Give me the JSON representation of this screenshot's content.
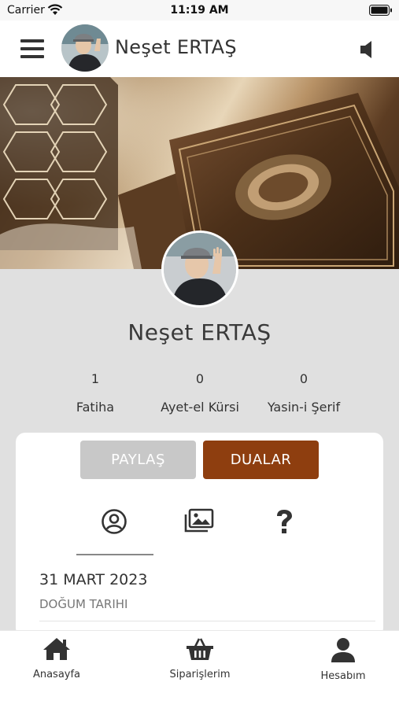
{
  "status_bar": {
    "carrier": "Carrier",
    "time": "11:19 AM"
  },
  "nav": {
    "title": "Neşet ERTAŞ",
    "menu_icon": "hamburger-icon",
    "sound_icon": "speaker-icon"
  },
  "profile": {
    "name": "Neşet ERTAŞ"
  },
  "stats": [
    {
      "count": "1",
      "label": "Fatiha"
    },
    {
      "count": "0",
      "label": "Ayet-el Kürsi"
    },
    {
      "count": "0",
      "label": "Yasin-i Şerif"
    }
  ],
  "card": {
    "share_label": "PAYLAŞ",
    "prayers_label": "DUALAR",
    "tab_icons": [
      "user-circle-icon",
      "gallery-icon",
      "question-icon"
    ],
    "date_value": "31 MART 2023",
    "date_label": "DOĞUM TARIHI"
  },
  "tab_bar": {
    "items": [
      {
        "label": "Anasayfa",
        "icon": "home-icon"
      },
      {
        "label": "Siparişlerim",
        "icon": "basket-icon"
      },
      {
        "label": "Hesabım",
        "icon": "account-icon"
      }
    ]
  },
  "colors": {
    "accent": "#8e3e0f",
    "share_button": "#c8c8c8",
    "page_background": "#e0e0e0"
  }
}
